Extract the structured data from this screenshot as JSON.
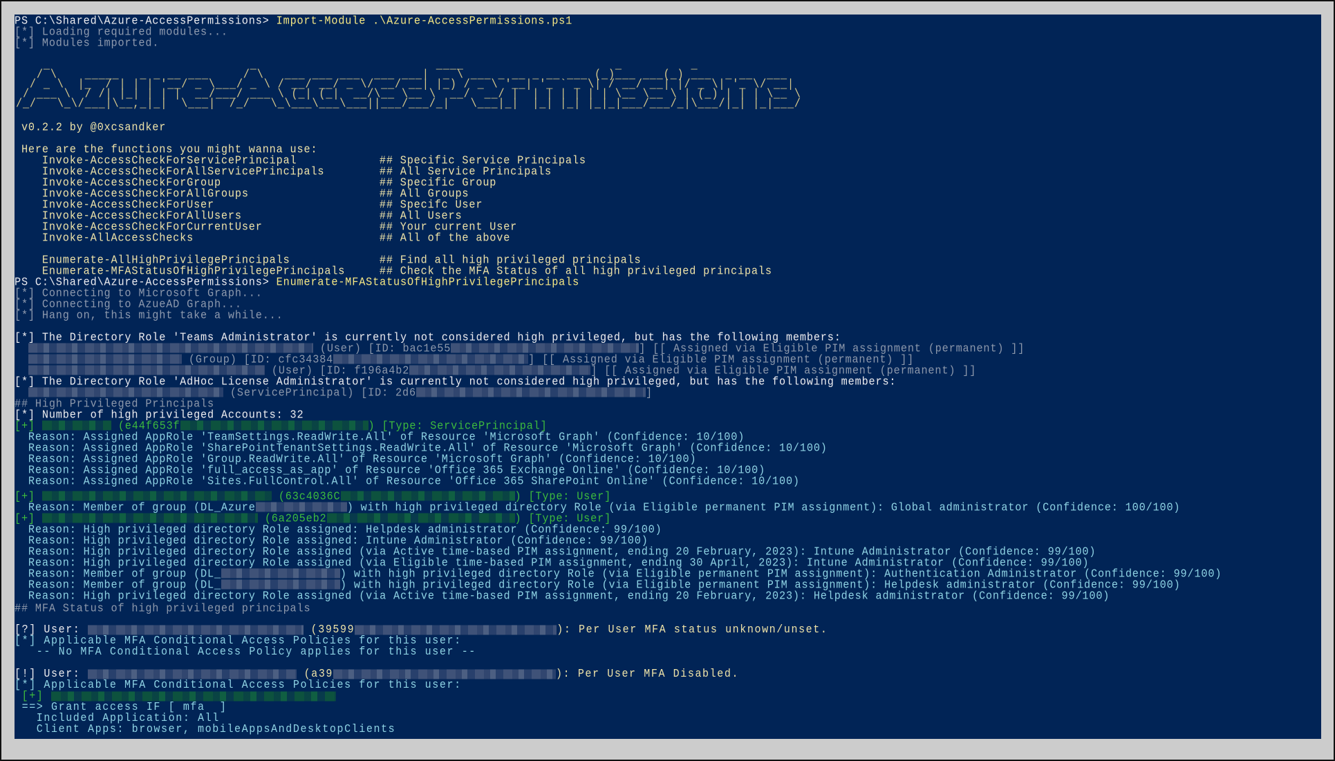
{
  "window": {
    "type": "powershell-console",
    "background": "#012456"
  },
  "lines": {
    "l1_prompt": "PS C:\\Shared\\Azure-AccessPermissions> ",
    "l1_cmd": "Import-Module .\\Azure-AccessPermissions.ps1",
    "l2": "[*] Loading required modules...",
    "l3": "[*] Modules imported.",
    "ascii": [
      "    _                             _                          ____                      _          _                ",
      "   / \\    _____   _ _ __ ___     / \\   ___ ___ ___  ___ ___|  _ \\ ___ _ __ _ __ ___ (_)___ ___(_) ___  _ __  ___ ",
      "  / _ \\  |_  / | | | '__/ _ \\___/ _ \\ / __/ __/ _ \\/ __/ __| |_) / _ \\ '__| '_ ` _ \\| / __/ __| |/ _ \\| '_ \\/ __|",
      " / ___ \\  / /| |_| | | |  __/___/ ___ \\ (_| (_|  __/\\__ \\__ \\  __/  __/ |  | | | | | | \\__ \\__ \\ | (_) | | | \\__ \\",
      "/_/   \\_\\/___|\\__,_|_|  \\___|  /_/   \\_\\___\\___\\___||___/___/_|   \\___|_|  |_| |_| |_|_|___/___/_|\\___/|_| |_|___/"
    ],
    "version": " v0.2.2 by @0xcsandker",
    "functions_header": " Here are the functions you might wanna use:",
    "functions": [
      {
        "name": "Invoke-AccessCheckForServicePrincipal",
        "comment": "## Specific Service Principals"
      },
      {
        "name": "Invoke-AccessCheckForAllServicePrincipals",
        "comment": "## All Service Principals"
      },
      {
        "name": "Invoke-AccessCheckForGroup",
        "comment": "## Specific Group"
      },
      {
        "name": "Invoke-AccessCheckForAllGroups",
        "comment": "## All Groups"
      },
      {
        "name": "Invoke-AccessCheckForUser",
        "comment": "## Specifc User"
      },
      {
        "name": "Invoke-AccessCheckForAllUsers",
        "comment": "## All Users"
      },
      {
        "name": "Invoke-AccessCheckForCurrentUser",
        "comment": "## Your current User"
      },
      {
        "name": "Invoke-AllAccessChecks",
        "comment": "## All of the above"
      }
    ],
    "enum_functions": [
      {
        "name": "Enumerate-AllHighPrivilegePrincipals",
        "comment": "## Find all high privileged principals"
      },
      {
        "name": "Enumerate-MFAStatusOfHighPrivilegePrincipals",
        "comment": "## Check the MFA Status of all high privileged principals"
      }
    ],
    "l2_prompt": "PS C:\\Shared\\Azure-AccessPermissions> ",
    "l2_cmd": "Enumerate-MFAStatusOfHighPrivilegePrincipals",
    "connecting": [
      "[*] Connecting to Microsoft Graph...",
      "[*] Connecting to AzueAD Graph...",
      "[*] Hang on, this might take a while..."
    ],
    "teams_role": "[*] The Directory Role 'Teams Administrator' is currently not considered high privileged, but has the following members:",
    "teams_members": [
      {
        "type": "(User) [ID: bac1e55",
        "tail": "] [[ Assigned via Eligible PIM assignment (permanent) ]]"
      },
      {
        "type": "(Group) [ID: cfc34384",
        "tail": "] [[ Assigned via Eligible PIM assignment (permanent) ]]"
      },
      {
        "type": "(User) [ID: f196a4b2",
        "tail": "] [[ Assigned via Eligible PIM assignment (permanent) ]]"
      }
    ],
    "adhoc_role": "[*] The Directory Role 'AdHoc License Administrator' is currently not considered high privileged, but has the following members:",
    "adhoc_members": [
      {
        "type": "(ServicePrincipal) [ID: 2d6",
        "tail": "]"
      }
    ],
    "hp_header": "## High Privileged Principals",
    "hp_count": "[*] Number of high privileged Accounts: 32",
    "principals": [
      {
        "marker": "[+]",
        "id": "(e44f653f",
        "type": ") [Type: ServicePrincipal]",
        "reasons": [
          "  Reason: Assigned AppRole 'TeamSettings.ReadWrite.All' of Resource 'Microsoft Graph' (Confidence: 10/100)",
          "  Reason: Assigned AppRole 'SharePointTenantSettings.ReadWrite.All' of Resource 'Microsoft Graph' (Confidence: 10/100)",
          "  Reason: Assigned AppRole 'Group.ReadWrite.All' of Resource 'Microsoft Graph' (Confidence: 10/100)",
          "  Reason: Assigned AppRole 'full_access_as_app' of Resource 'Office 365 Exchange Online' (Confidence: 10/100)",
          "  Reason: Assigned AppRole 'Sites.FullControl.All' of Resource 'Office 365 SharePoint Online' (Confidence: 10/100)"
        ]
      },
      {
        "marker": "[+]",
        "id": "(63c4036C",
        "type": ") [Type: User]",
        "reasons_group": [
          {
            "pre": "  Reason: Member of group (DL_Azure",
            "post": ") with high privileged directory Role (via Eligible permanent PIM assignment): Global administrator (Confidence: 100/100)"
          }
        ]
      },
      {
        "marker": "[+]",
        "id": "(6a205eb2",
        "type": ") [Type: User]",
        "reasons": [
          "  Reason: High privileged directory Role assigned: Helpdesk administrator (Confidence: 99/100)",
          "  Reason: High privileged directory Role assigned: Intune Administrator (Confidence: 99/100)",
          "  Reason: High privileged directory Role assigned (via Active time-based PIM assignment, ending 20 February, 2023): Intune Administrator (Confidence: 99/100)",
          "  Reason: High privileged directory Role assigned (via Eligible time-based PIM assignment, ending 30 April, 2023): Intune Administrator (Confidence: 99/100)"
        ],
        "reasons_group": [
          {
            "pre": "  Reason: Member of group (DL_",
            "post": ") with high privileged directory Role (via Eligible permanent PIM assignment): Authentication Administrator (Confidence: 99/100)"
          },
          {
            "pre": "  Reason: Member of group (DL_",
            "post": ") with high privileged directory Role (via Eligible permanent PIM assignment): Helpdesk administrator (Confidence: 99/100)"
          }
        ],
        "reasons_after": [
          "  Reason: High privileged directory Role assigned (via Active time-based PIM assignment, ending 20 February, 2023): Helpdesk administrator (Confidence: 99/100)"
        ]
      }
    ],
    "mfa_header": "## MFA Status of high privileged principals",
    "mfa_users": [
      {
        "marker": "[?] User: ",
        "id": "(39599",
        "status": "): Per User MFA status unknown/unset.",
        "ca_header": "[*] Applicable MFA Conditional Access Policies for this user:",
        "ca_none": "   -- No MFA Conditional Access Policy applies for this user --"
      },
      {
        "marker": "[!] User: ",
        "id": "(a39",
        "status": "): Per User MFA Disabled.",
        "ca_header": "[*] Applicable MFA Conditional Access Policies for this user:",
        "ca_policy_marker": " [+]",
        "grant": " ==> Grant access IF [ mfa  ]",
        "included_app": "   Included Application: All",
        "client_apps": "   Client Apps: browser, mobileAppsAndDesktopClients"
      }
    ]
  }
}
